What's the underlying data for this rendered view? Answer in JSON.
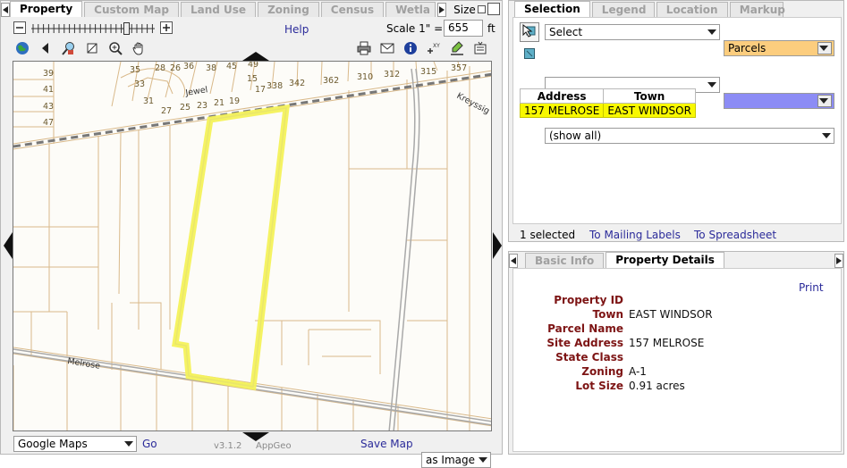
{
  "left": {
    "tabs": [
      "Property",
      "Custom Map",
      "Land Use",
      "Zoning",
      "Census",
      "Wetla"
    ],
    "active_tab": "Property",
    "size_label": "Size",
    "help_label": "Help",
    "scale_label": "Scale 1\" =",
    "scale_value": "655",
    "scale_unit": "ft",
    "zoom_level": 0.78,
    "toolbar_icons_left": [
      "globe-icon",
      "back-arrow-icon",
      "zoom-to-selection-icon",
      "zoom-box-icon",
      "zoom-in-icon",
      "pan-hand-icon"
    ],
    "toolbar_icons_right": [
      "print-icon",
      "email-icon",
      "info-icon",
      "xy-coordinates-icon",
      "markup-icon",
      "identify-icon"
    ],
    "map_labels": {
      "parcels": [
        "39",
        "41",
        "43",
        "47",
        "35",
        "33",
        "31",
        "27",
        "25",
        "23",
        "21",
        "19",
        "28",
        "26",
        "36",
        "38",
        "45",
        "49",
        "15",
        "17",
        "338",
        "342",
        "362",
        "310",
        "312",
        "315",
        "357"
      ],
      "roads": [
        "Jewel",
        "Melrose",
        "Kreyssig"
      ]
    },
    "basemap_select": "Google Maps",
    "go_label": "Go",
    "version": "v3.1.2",
    "brand": "AppGeo",
    "save_map_label": "Save Map",
    "save_format": "as Image"
  },
  "selection": {
    "tabs": [
      "Selection",
      "Legend",
      "Location",
      "Markup"
    ],
    "active_tab": "Selection",
    "tool_select": "Select",
    "layer_select": "Parcels",
    "layer_color": "#fccd7e",
    "second_select": "",
    "second_color": "#8c8cf5",
    "filter_select": "(show all)",
    "table": {
      "headers": [
        "Address",
        "Town"
      ],
      "rows": [
        [
          "157 MELROSE",
          "EAST WINDSOR"
        ]
      ]
    },
    "count_text": "1 selected",
    "mailing_link": "To Mailing Labels",
    "spreadsheet_link": "To Spreadsheet"
  },
  "details": {
    "tabs": [
      "Basic Info",
      "Property Details"
    ],
    "active_tab": "Property Details",
    "print_label": "Print",
    "fields": [
      {
        "label": "Property ID",
        "value": ""
      },
      {
        "label": "Town",
        "value": "EAST WINDSOR"
      },
      {
        "label": "Parcel Name",
        "value": ""
      },
      {
        "label": "Site Address",
        "value": "157 MELROSE"
      },
      {
        "label": "State Class",
        "value": ""
      },
      {
        "label": "Zoning",
        "value": "A-1"
      },
      {
        "label": "Lot Size",
        "value": "0.91 acres"
      }
    ]
  },
  "colors": {
    "selection_highlight": "#f8f800",
    "label_color": "#7d1414",
    "link_color": "#2b2b9a",
    "parcel_line": "#d9b98a"
  }
}
